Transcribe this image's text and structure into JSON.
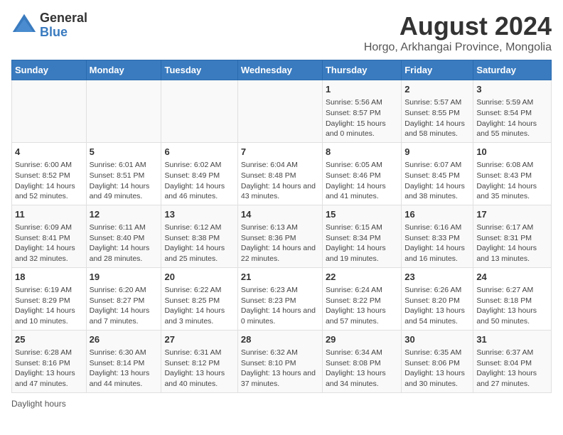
{
  "logo": {
    "general": "General",
    "blue": "Blue"
  },
  "title": "August 2024",
  "subtitle": "Horgo, Arkhangai Province, Mongolia",
  "days_of_week": [
    "Sunday",
    "Monday",
    "Tuesday",
    "Wednesday",
    "Thursday",
    "Friday",
    "Saturday"
  ],
  "weeks": [
    [
      {
        "day": "",
        "info": ""
      },
      {
        "day": "",
        "info": ""
      },
      {
        "day": "",
        "info": ""
      },
      {
        "day": "",
        "info": ""
      },
      {
        "day": "1",
        "info": "Sunrise: 5:56 AM\nSunset: 8:57 PM\nDaylight: 15 hours and 0 minutes."
      },
      {
        "day": "2",
        "info": "Sunrise: 5:57 AM\nSunset: 8:55 PM\nDaylight: 14 hours and 58 minutes."
      },
      {
        "day": "3",
        "info": "Sunrise: 5:59 AM\nSunset: 8:54 PM\nDaylight: 14 hours and 55 minutes."
      }
    ],
    [
      {
        "day": "4",
        "info": "Sunrise: 6:00 AM\nSunset: 8:52 PM\nDaylight: 14 hours and 52 minutes."
      },
      {
        "day": "5",
        "info": "Sunrise: 6:01 AM\nSunset: 8:51 PM\nDaylight: 14 hours and 49 minutes."
      },
      {
        "day": "6",
        "info": "Sunrise: 6:02 AM\nSunset: 8:49 PM\nDaylight: 14 hours and 46 minutes."
      },
      {
        "day": "7",
        "info": "Sunrise: 6:04 AM\nSunset: 8:48 PM\nDaylight: 14 hours and 43 minutes."
      },
      {
        "day": "8",
        "info": "Sunrise: 6:05 AM\nSunset: 8:46 PM\nDaylight: 14 hours and 41 minutes."
      },
      {
        "day": "9",
        "info": "Sunrise: 6:07 AM\nSunset: 8:45 PM\nDaylight: 14 hours and 38 minutes."
      },
      {
        "day": "10",
        "info": "Sunrise: 6:08 AM\nSunset: 8:43 PM\nDaylight: 14 hours and 35 minutes."
      }
    ],
    [
      {
        "day": "11",
        "info": "Sunrise: 6:09 AM\nSunset: 8:41 PM\nDaylight: 14 hours and 32 minutes."
      },
      {
        "day": "12",
        "info": "Sunrise: 6:11 AM\nSunset: 8:40 PM\nDaylight: 14 hours and 28 minutes."
      },
      {
        "day": "13",
        "info": "Sunrise: 6:12 AM\nSunset: 8:38 PM\nDaylight: 14 hours and 25 minutes."
      },
      {
        "day": "14",
        "info": "Sunrise: 6:13 AM\nSunset: 8:36 PM\nDaylight: 14 hours and 22 minutes."
      },
      {
        "day": "15",
        "info": "Sunrise: 6:15 AM\nSunset: 8:34 PM\nDaylight: 14 hours and 19 minutes."
      },
      {
        "day": "16",
        "info": "Sunrise: 6:16 AM\nSunset: 8:33 PM\nDaylight: 14 hours and 16 minutes."
      },
      {
        "day": "17",
        "info": "Sunrise: 6:17 AM\nSunset: 8:31 PM\nDaylight: 14 hours and 13 minutes."
      }
    ],
    [
      {
        "day": "18",
        "info": "Sunrise: 6:19 AM\nSunset: 8:29 PM\nDaylight: 14 hours and 10 minutes."
      },
      {
        "day": "19",
        "info": "Sunrise: 6:20 AM\nSunset: 8:27 PM\nDaylight: 14 hours and 7 minutes."
      },
      {
        "day": "20",
        "info": "Sunrise: 6:22 AM\nSunset: 8:25 PM\nDaylight: 14 hours and 3 minutes."
      },
      {
        "day": "21",
        "info": "Sunrise: 6:23 AM\nSunset: 8:23 PM\nDaylight: 14 hours and 0 minutes."
      },
      {
        "day": "22",
        "info": "Sunrise: 6:24 AM\nSunset: 8:22 PM\nDaylight: 13 hours and 57 minutes."
      },
      {
        "day": "23",
        "info": "Sunrise: 6:26 AM\nSunset: 8:20 PM\nDaylight: 13 hours and 54 minutes."
      },
      {
        "day": "24",
        "info": "Sunrise: 6:27 AM\nSunset: 8:18 PM\nDaylight: 13 hours and 50 minutes."
      }
    ],
    [
      {
        "day": "25",
        "info": "Sunrise: 6:28 AM\nSunset: 8:16 PM\nDaylight: 13 hours and 47 minutes."
      },
      {
        "day": "26",
        "info": "Sunrise: 6:30 AM\nSunset: 8:14 PM\nDaylight: 13 hours and 44 minutes."
      },
      {
        "day": "27",
        "info": "Sunrise: 6:31 AM\nSunset: 8:12 PM\nDaylight: 13 hours and 40 minutes."
      },
      {
        "day": "28",
        "info": "Sunrise: 6:32 AM\nSunset: 8:10 PM\nDaylight: 13 hours and 37 minutes."
      },
      {
        "day": "29",
        "info": "Sunrise: 6:34 AM\nSunset: 8:08 PM\nDaylight: 13 hours and 34 minutes."
      },
      {
        "day": "30",
        "info": "Sunrise: 6:35 AM\nSunset: 8:06 PM\nDaylight: 13 hours and 30 minutes."
      },
      {
        "day": "31",
        "info": "Sunrise: 6:37 AM\nSunset: 8:04 PM\nDaylight: 13 hours and 27 minutes."
      }
    ]
  ],
  "footer": {
    "label": "Daylight hours"
  }
}
